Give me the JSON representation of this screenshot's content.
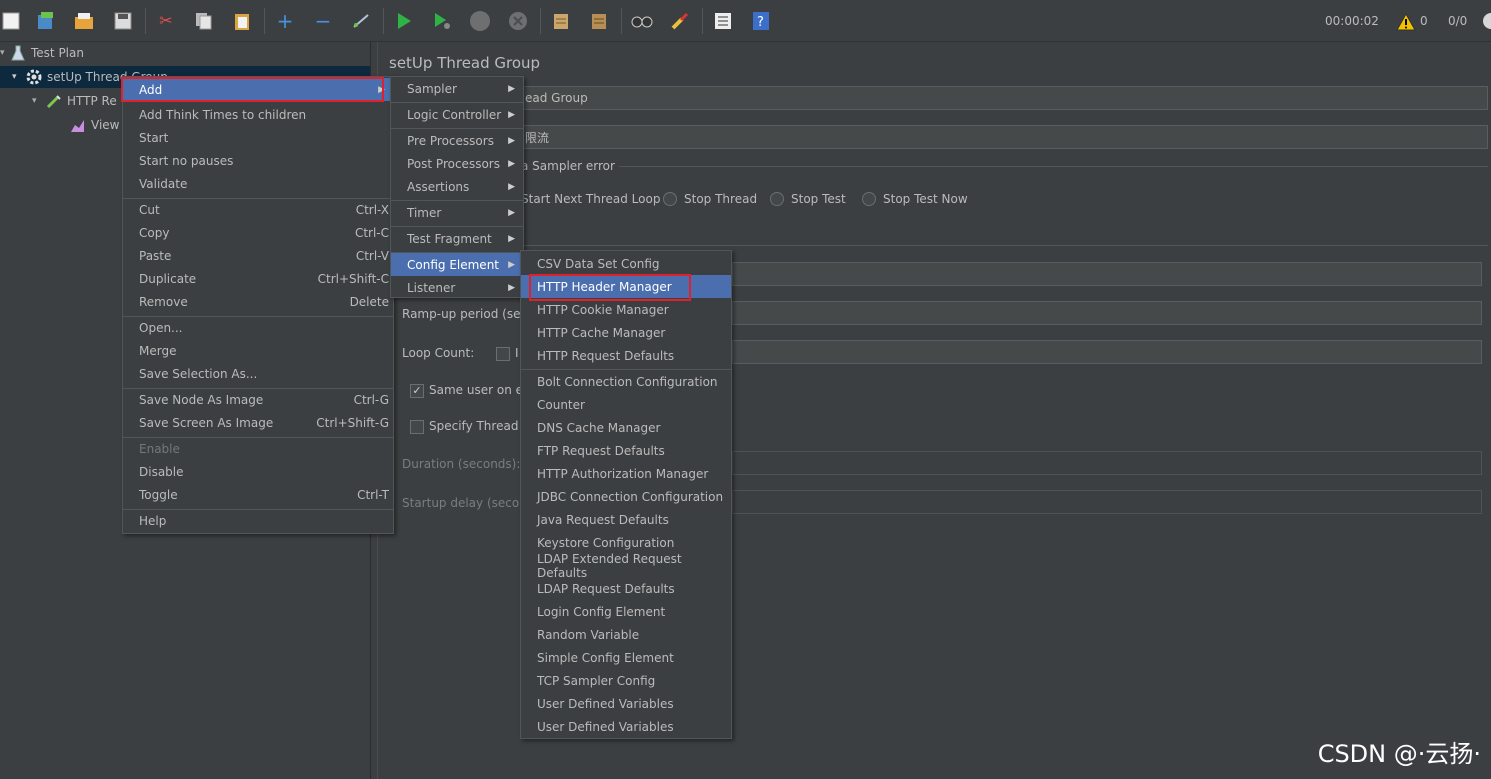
{
  "toolbar": {
    "elapsed": "00:00:02",
    "warnings": "0",
    "threads": "0/0"
  },
  "tree": {
    "test_plan": "Test Plan",
    "thread_group": "setUp Thread Group",
    "http_request": "HTTP Re",
    "view_results": "View"
  },
  "panel": {
    "title": "setUp Thread Group",
    "name_value": "ead Group",
    "comments_value": "限流",
    "sampler_error_label": "a Sampler error",
    "start_next_loop": "Start Next Thread Loop",
    "stop_thread": "Stop Thread",
    "stop_test": "Stop Test",
    "stop_test_now": "Stop Test Now",
    "ramp_up": "Ramp-up period (sec",
    "loop_count": "Loop Count:",
    "loop_infinite": "I",
    "same_user": "Same user on ea",
    "specify_lifetime": "Specify Thread li",
    "duration": "Duration (seconds):",
    "startup_delay": "Startup delay (second"
  },
  "context_menu": {
    "items": [
      {
        "label": "Add",
        "shortcut": "",
        "arrow": true
      },
      {
        "label": "Add Think Times to children",
        "shortcut": ""
      },
      {
        "label": "Start",
        "shortcut": ""
      },
      {
        "label": "Start no pauses",
        "shortcut": ""
      },
      {
        "label": "Validate",
        "shortcut": ""
      },
      {
        "label": "Cut",
        "shortcut": "Ctrl-X"
      },
      {
        "label": "Copy",
        "shortcut": "Ctrl-C"
      },
      {
        "label": "Paste",
        "shortcut": "Ctrl-V"
      },
      {
        "label": "Duplicate",
        "shortcut": "Ctrl+Shift-C"
      },
      {
        "label": "Remove",
        "shortcut": "Delete"
      },
      {
        "label": "Open...",
        "shortcut": ""
      },
      {
        "label": "Merge",
        "shortcut": ""
      },
      {
        "label": "Save Selection As...",
        "shortcut": ""
      },
      {
        "label": "Save Node As Image",
        "shortcut": "Ctrl-G"
      },
      {
        "label": "Save Screen As Image",
        "shortcut": "Ctrl+Shift-G"
      },
      {
        "label": "Enable",
        "shortcut": ""
      },
      {
        "label": "Disable",
        "shortcut": ""
      },
      {
        "label": "Toggle",
        "shortcut": "Ctrl-T"
      },
      {
        "label": "Help",
        "shortcut": ""
      }
    ]
  },
  "add_menu": {
    "items": [
      {
        "label": "Sampler"
      },
      {
        "label": "Logic Controller"
      },
      {
        "label": "Pre Processors"
      },
      {
        "label": "Post Processors"
      },
      {
        "label": "Assertions"
      },
      {
        "label": "Timer"
      },
      {
        "label": "Test Fragment"
      },
      {
        "label": "Config Element"
      },
      {
        "label": "Listener"
      }
    ]
  },
  "config_menu": {
    "items": [
      {
        "label": "CSV Data Set Config"
      },
      {
        "label": "HTTP Header Manager"
      },
      {
        "label": "HTTP Cookie Manager"
      },
      {
        "label": "HTTP Cache Manager"
      },
      {
        "label": "HTTP Request Defaults"
      },
      {
        "label": "Bolt Connection Configuration"
      },
      {
        "label": "Counter"
      },
      {
        "label": "DNS Cache Manager"
      },
      {
        "label": "FTP Request Defaults"
      },
      {
        "label": "HTTP Authorization Manager"
      },
      {
        "label": "JDBC Connection Configuration"
      },
      {
        "label": "Java Request Defaults"
      },
      {
        "label": "Keystore Configuration"
      },
      {
        "label": "LDAP Extended Request Defaults"
      },
      {
        "label": "LDAP Request Defaults"
      },
      {
        "label": "Login Config Element"
      },
      {
        "label": "Random Variable"
      },
      {
        "label": "Simple Config Element"
      },
      {
        "label": "TCP Sampler Config"
      },
      {
        "label": "User Defined Variables"
      },
      {
        "label": "User Defined Variables"
      }
    ]
  },
  "watermark": "CSDN @·云扬·",
  "colors": {
    "background": "#3c3f41",
    "highlight": "#4b6eaf",
    "selection": "#0d293e",
    "annotation": "#e0202a"
  }
}
